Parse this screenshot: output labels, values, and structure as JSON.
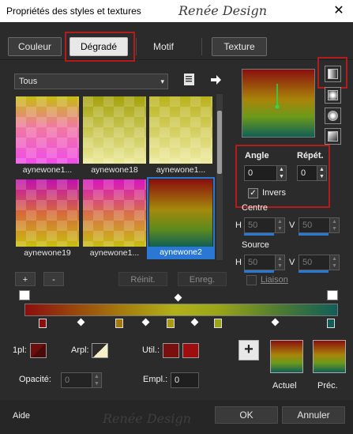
{
  "window": {
    "title": "Propriétés des styles et textures",
    "logo": "Renée Design",
    "close_glyph": "✕"
  },
  "tabs": [
    {
      "label": "Couleur"
    },
    {
      "label": "Dégradé",
      "active": true
    },
    {
      "label": "Motif"
    },
    {
      "label": "Texture"
    }
  ],
  "library": {
    "category": "Tous",
    "arrow_glyph": "▾",
    "book_icon": "book-icon",
    "nav_icon": "arrow-right-icon",
    "thumbs": [
      {
        "label": "aynewone1..."
      },
      {
        "label": "aynewone18"
      },
      {
        "label": "aynewone1..."
      },
      {
        "label": "aynewone19"
      },
      {
        "label": "aynewone1..."
      },
      {
        "label": "aynewone2",
        "selected": true
      }
    ]
  },
  "controls": {
    "add_label": "+",
    "remove_label": "-",
    "reset_label": "Réinit.",
    "save_label": "Enreg."
  },
  "settings": {
    "angle_label": "Angle",
    "angle_value": "0",
    "repeat_label": "Répét.",
    "repeat_value": "0",
    "invert_label": "Invers",
    "invert_checked": true,
    "invert_check_glyph": "✓",
    "center_label": "Centre",
    "center_h_label": "H",
    "center_h_value": "50",
    "center_v_label": "V",
    "center_v_value": "50",
    "source_label": "Source",
    "source_h_label": "H",
    "source_h_value": "50",
    "source_v_label": "V",
    "source_v_value": "50",
    "link_label": "Liaison"
  },
  "editor": {
    "one_pl_label": "1pl:",
    "arpl_label": "Arpl:",
    "util_label": "Util.:",
    "opacity_label": "Opacité:",
    "opacity_value": "0",
    "empl_label": "Empl.:",
    "empl_value": "0",
    "util_color_1": "#7a0f0f",
    "util_color_2": "#9e0e0e"
  },
  "preview": {
    "add_glyph": "+",
    "current_label": "Actuel",
    "previous_label": "Préc."
  },
  "footer": {
    "help_label": "Aide",
    "logo": "Renée Design",
    "ok_label": "OK",
    "cancel_label": "Annuler"
  },
  "colors": {
    "accent": "#2a78d4",
    "highlight": "#b41c1c"
  }
}
